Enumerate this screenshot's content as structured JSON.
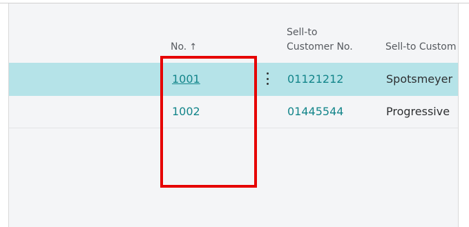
{
  "table": {
    "columns": {
      "no_label": "No.",
      "sort_icon": "arrow-up-icon",
      "sell_to_customer_no_line1": "Sell-to",
      "sell_to_customer_no_line2": "Customer No.",
      "sell_to_customer_name": "Sell-to Custom"
    },
    "rows": [
      {
        "no": "1001",
        "customer_no": "01121212",
        "customer_name": "Spotsmeyer",
        "selected": true
      },
      {
        "no": "1002",
        "customer_no": "01445544",
        "customer_name": "Progressive",
        "selected": false
      }
    ]
  },
  "colors": {
    "selected_row": "#b5e3e8",
    "link": "#13858a",
    "highlight": "#e60000"
  }
}
